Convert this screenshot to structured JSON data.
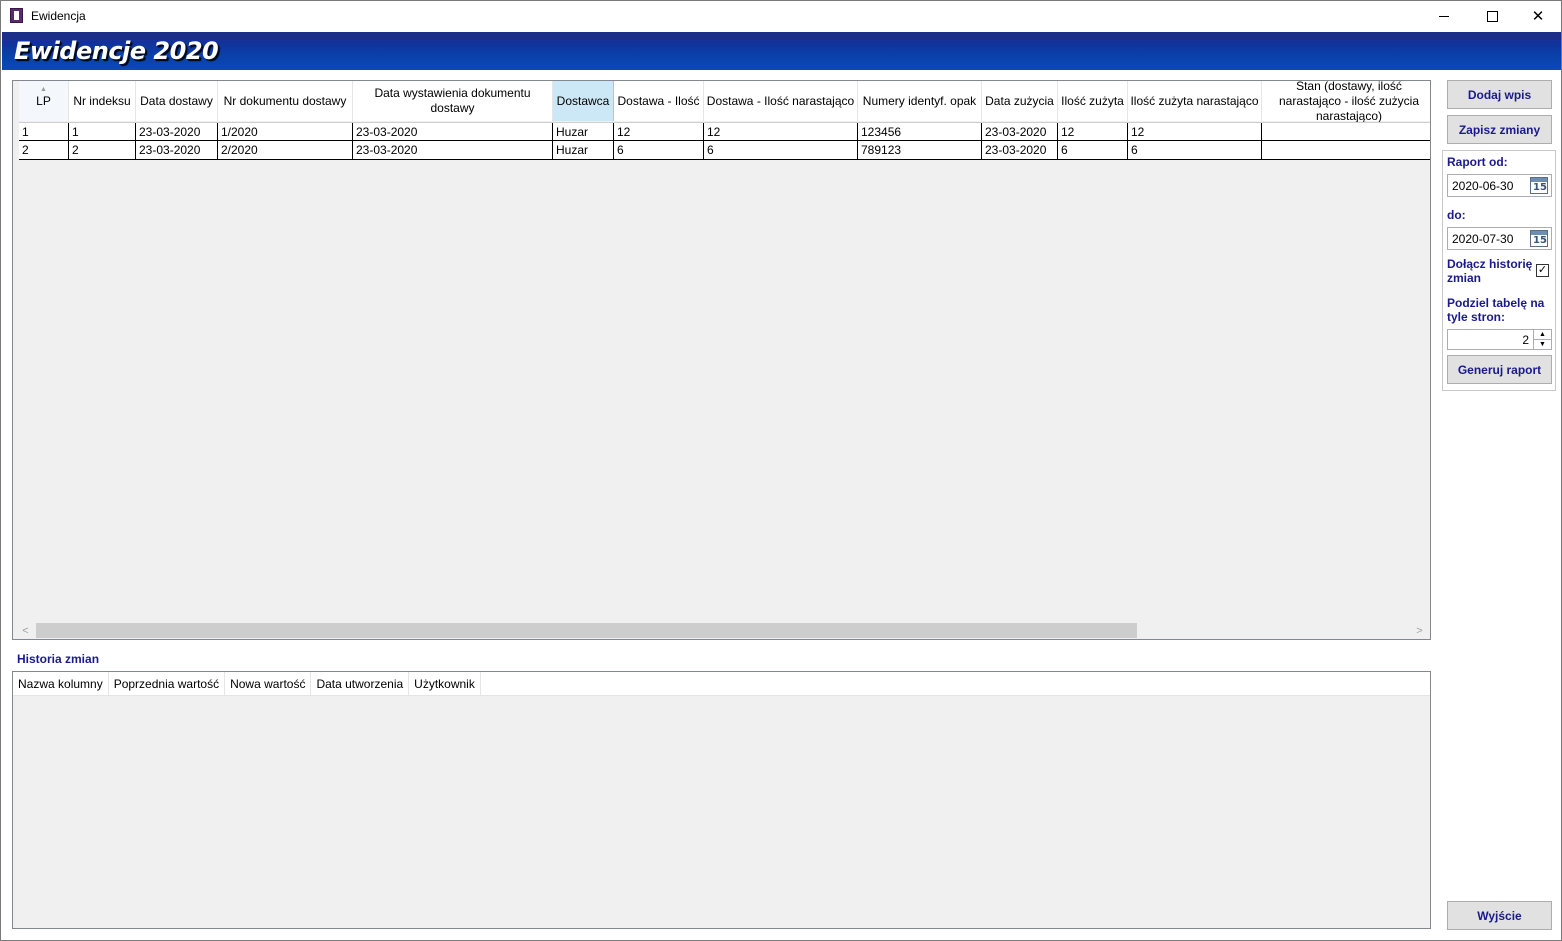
{
  "window": {
    "title": "Ewidencja",
    "banner_title": "Ewidencje 2020"
  },
  "grid": {
    "columns": [
      {
        "label": "LP"
      },
      {
        "label": "Nr indeksu"
      },
      {
        "label": "Data dostawy"
      },
      {
        "label": "Nr dokumentu dostawy"
      },
      {
        "label": "Data wystawienia dokumentu dostawy"
      },
      {
        "label": "Dostawca"
      },
      {
        "label": "Dostawa - Ilość"
      },
      {
        "label": "Dostawa - Ilość narastająco"
      },
      {
        "label": "Numery identyf. opak"
      },
      {
        "label": "Data zużycia"
      },
      {
        "label": "Ilość zużyta"
      },
      {
        "label": "Ilość zużyta narastająco"
      },
      {
        "label": "Stan (dostawy, ilość narastająco - ilość zużycia narastająco)"
      }
    ],
    "rows": [
      [
        "1",
        "1",
        "23-03-2020",
        "1/2020",
        "23-03-2020",
        "Huzar",
        "12",
        "12",
        "123456",
        "23-03-2020",
        "12",
        "12",
        ""
      ],
      [
        "2",
        "2",
        "23-03-2020",
        "2/2020",
        "23-03-2020",
        "Huzar",
        "6",
        "6",
        "789123",
        "23-03-2020",
        "6",
        "6",
        ""
      ]
    ]
  },
  "history": {
    "label": "Historia zmian",
    "columns": [
      "Nazwa kolumny",
      "Poprzednia wartość",
      "Nowa wartość",
      "Data utworzenia",
      "Użytkownik"
    ]
  },
  "side": {
    "add_label": "Dodaj wpis",
    "save_label": "Zapisz zmiany",
    "report_from_label": "Raport od:",
    "report_from_value": "2020-06-30",
    "report_to_label": "do:",
    "report_to_value": "2020-07-30",
    "calendar_day": "15",
    "include_history_label": "Dołącz historię zmian",
    "include_history_checked": true,
    "split_label": "Podziel tabelę na tyle stron:",
    "split_value": "2",
    "generate_label": "Generuj raport",
    "exit_label": "Wyjście"
  },
  "colors": {
    "banner": "#0a3fa8",
    "label_text": "#1a1a8c",
    "selected_header": "#cce8f7"
  },
  "icons": [
    "app-icon",
    "minimize-icon",
    "maximize-icon",
    "close-icon",
    "calendar-icon",
    "sort-up-icon",
    "scroll-left-icon",
    "scroll-right-icon",
    "spin-up-icon",
    "spin-down-icon",
    "checkmark-icon"
  ]
}
